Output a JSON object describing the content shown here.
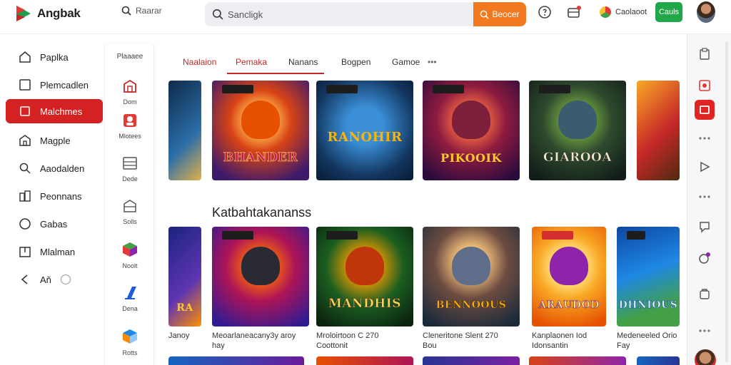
{
  "header": {
    "app_name": "Angbak",
    "small_search_label": "Raarar",
    "search_placeholder": "Sancligk",
    "search_button": "Beocer",
    "country_label": "Caolaoot",
    "green_button": "Cauls",
    "accent": "#d42121",
    "search_button_color": "#f2791f",
    "green_color": "#1fa74a"
  },
  "sidebar": {
    "items": [
      {
        "label": "Paplka",
        "icon": "home-icon"
      },
      {
        "label": "Plemcadlen",
        "icon": "square-icon"
      },
      {
        "label": "Malchmes",
        "icon": "square-icon",
        "active": true
      },
      {
        "label": "Magple",
        "icon": "building-icon"
      },
      {
        "label": "Aaodalden",
        "icon": "search-icon"
      },
      {
        "label": "Peonnans",
        "icon": "city-icon"
      },
      {
        "label": "Gabas",
        "icon": "circle-icon"
      },
      {
        "label": "Mlalman",
        "icon": "library-icon"
      }
    ],
    "footer_label": "Aň"
  },
  "rail": {
    "heading": "Plaaaee",
    "items": [
      "Dom",
      "Mlotees",
      "Dede",
      "Solls",
      "Noolt",
      "Dena",
      "Rotts"
    ]
  },
  "tabs": [
    "Naalaion",
    "Pemaka",
    "Nanans",
    "Bogpen",
    "Gamoe"
  ],
  "tabs_more": "•••",
  "section_title": "Katbahtakananss",
  "row1": [
    "",
    "BHANDER",
    "RANOHIR",
    "PIKOOIK",
    "GIAROOA",
    ""
  ],
  "row2": [
    {
      "title": "RA",
      "caption1": "Janoy",
      "caption2": ""
    },
    {
      "title": "",
      "caption1": "Meoarlaneacany3y aroy",
      "caption2": "hay"
    },
    {
      "title": "MANDHIS",
      "caption1": "Mroloirtoon C 270",
      "caption2": "Coottonit"
    },
    {
      "title": "BENNOOUS",
      "caption1": "Cleneritone Slent 270",
      "caption2": "Bou"
    },
    {
      "title": "ARAUDOD",
      "caption1": "Kanplaonen Iod",
      "caption2": "Idonsantin"
    },
    {
      "title": "DHNIOUS",
      "caption1": "Medeneeled Orio",
      "caption2": "Fay"
    }
  ]
}
